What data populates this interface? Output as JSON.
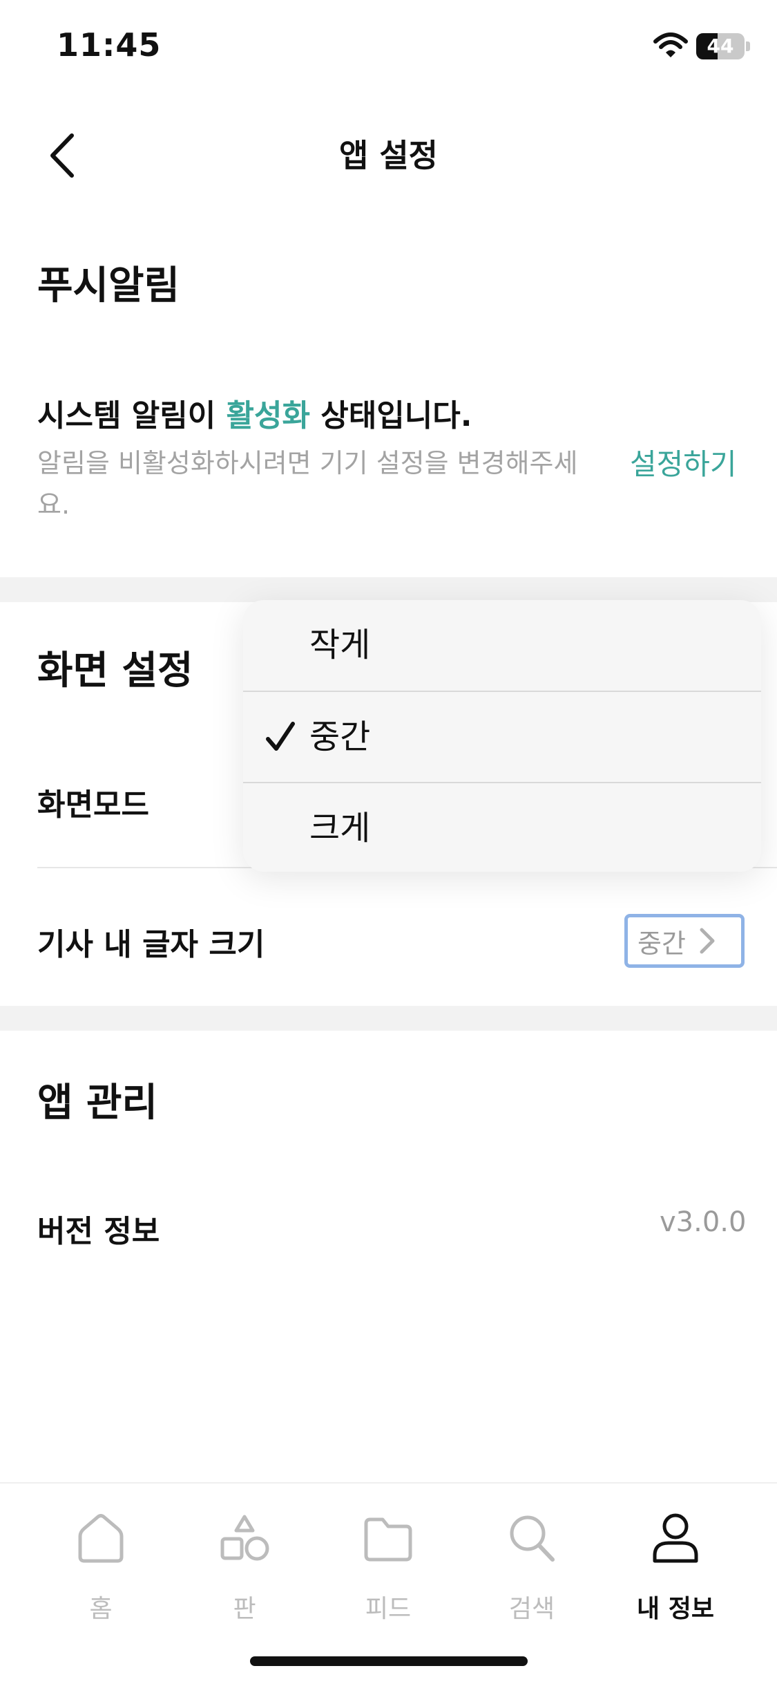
{
  "status_bar": {
    "time": "11:45",
    "battery_level": 44
  },
  "nav": {
    "title": "앱 설정"
  },
  "push_section": {
    "title": "푸시알림",
    "status_prefix": "시스템 알림이 ",
    "status_accent": "활성화",
    "status_suffix": " 상태입니다.",
    "description": "알림을 비활성화하시려면 기기 설정을 변경해주세요.",
    "setup_link": "설정하기"
  },
  "display_section": {
    "title": "화면 설정",
    "mode_label": "화면모드",
    "font_size_label": "기사 내 글자 크기",
    "font_size_value": "중간"
  },
  "font_size_menu": {
    "options": [
      "작게",
      "중간",
      "크게"
    ],
    "selected": "중간"
  },
  "app_section": {
    "title": "앱 관리",
    "version_label": "버전 정보",
    "version_value": "v3.0.0"
  },
  "tabs": [
    {
      "label": "홈",
      "icon": "home-icon",
      "active": false
    },
    {
      "label": "판",
      "icon": "shapes-icon",
      "active": false
    },
    {
      "label": "피드",
      "icon": "folder-icon",
      "active": false
    },
    {
      "label": "검색",
      "icon": "search-icon",
      "active": false
    },
    {
      "label": "내 정보",
      "icon": "profile-icon",
      "active": true
    }
  ],
  "colors": {
    "accent": "#3aa59a",
    "muted_text": "#a3a3a3",
    "focus_ring": "#8fb3e6",
    "inactive_tab": "#bcbcbc"
  }
}
